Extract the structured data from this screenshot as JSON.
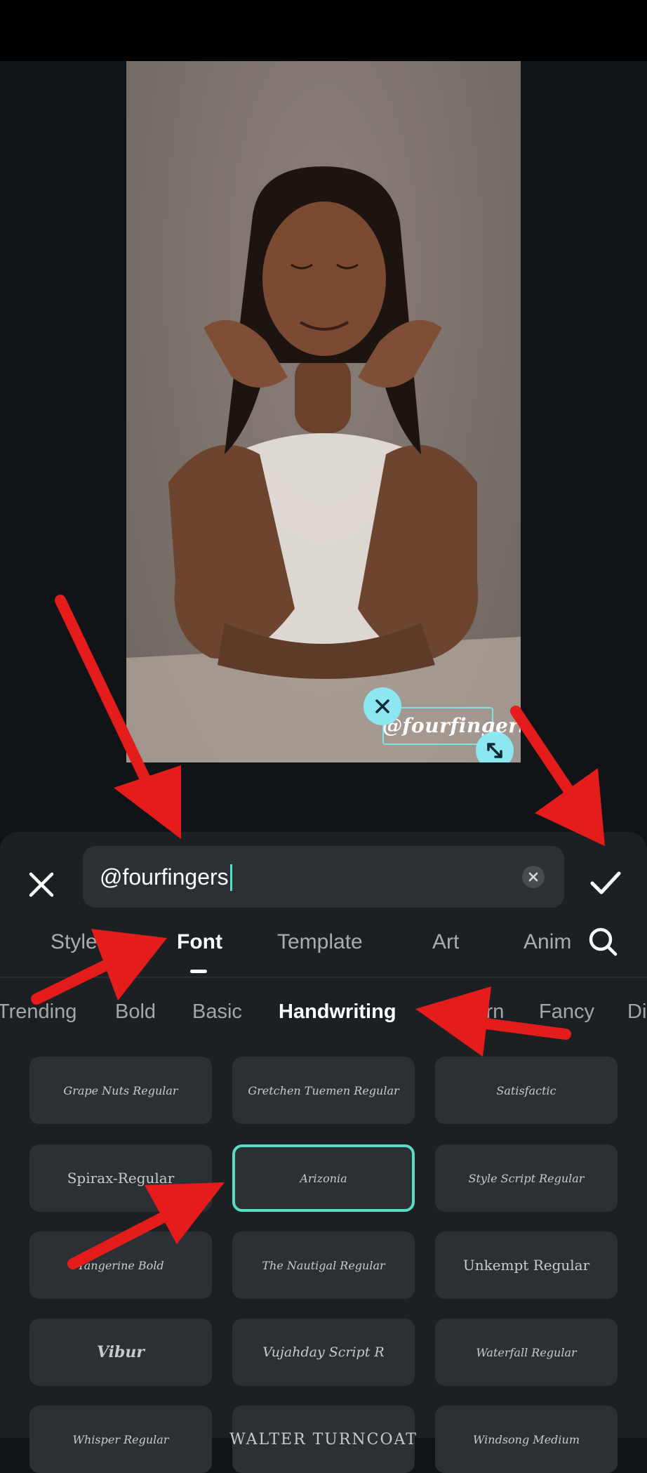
{
  "editor": {
    "text_value": "@fourfingers",
    "overlay_text": "@fourfingers"
  },
  "tabs": [
    {
      "label": "Style"
    },
    {
      "label": "Font"
    },
    {
      "label": "Template"
    },
    {
      "label": "Art"
    },
    {
      "label": "Anim"
    }
  ],
  "active_tab": "Font",
  "categories": [
    {
      "label": "Trending"
    },
    {
      "label": "Bold"
    },
    {
      "label": "Basic"
    },
    {
      "label": "Handwriting"
    },
    {
      "label": "Modern"
    },
    {
      "label": "Fancy"
    },
    {
      "label": "Di"
    }
  ],
  "active_category": "Handwriting",
  "fonts": [
    {
      "label": "Grape Nuts Regular"
    },
    {
      "label": "Gretchen Tuemen Regular"
    },
    {
      "label": "Satisfactic"
    },
    {
      "label": "Spirax-Regular"
    },
    {
      "label": "Arizonia"
    },
    {
      "label": "Style Script Regular"
    },
    {
      "label": "Tangerine Bold"
    },
    {
      "label": "The Nautigal Regular"
    },
    {
      "label": "Unkempt Regular"
    },
    {
      "label": "Vibur"
    },
    {
      "label": "Vujahday Script R"
    },
    {
      "label": "Waterfall Regular"
    },
    {
      "label": "Whisper Regular"
    },
    {
      "label": "WALTER TURNCOAT"
    },
    {
      "label": "Windsong Medium"
    }
  ],
  "selected_font": "Arizonia",
  "colors": {
    "accent": "#59dcc6",
    "handle": "#8ce7f0",
    "panel": "#1d2023",
    "tile": "#2c3034",
    "annotation_arrow": "#e51c1c"
  },
  "icons": {
    "close": "close-icon",
    "confirm": "checkmark-icon",
    "clear": "clear-x-icon",
    "search": "search-icon",
    "play": "play-icon",
    "resize": "resize-arrows-icon"
  }
}
